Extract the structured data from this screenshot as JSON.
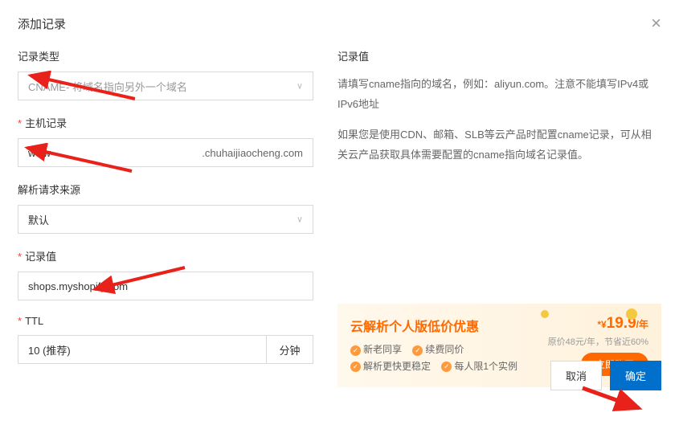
{
  "dialog": {
    "title": "添加记录"
  },
  "fields": {
    "recordType": {
      "label": "记录类型",
      "value": "CNAME- 将域名指向另外一个域名"
    },
    "hostRecord": {
      "label": "主机记录",
      "value": "www",
      "suffix": ".chuhaijiaocheng.com"
    },
    "requestSource": {
      "label": "解析请求来源",
      "value": "默认"
    },
    "recordValue": {
      "label": "记录值",
      "value": "shops.myshopify.com"
    },
    "ttl": {
      "label": "TTL",
      "value": "10 (推荐)",
      "unit": "分钟"
    }
  },
  "help": {
    "title": "记录值",
    "desc1": "请填写cname指向的域名，例如：aliyun.com。注意不能填写IPv4或IPv6地址",
    "desc2": "如果您是使用CDN、邮箱、SLB等云产品时配置cname记录，可从相关云产品获取具体需要配置的cname指向域名记录值。"
  },
  "promo": {
    "title": "云解析个人版低价优惠",
    "features": [
      "新老同享",
      "续费同价",
      "解析更快更稳定",
      "每人限1个实例"
    ],
    "priceSymbol": "*¥",
    "price": "19.9",
    "priceUnit": "/年",
    "sub": "原价48元/年，节省近60%",
    "btn": "立即购买"
  },
  "footer": {
    "cancel": "取消",
    "confirm": "确定"
  }
}
